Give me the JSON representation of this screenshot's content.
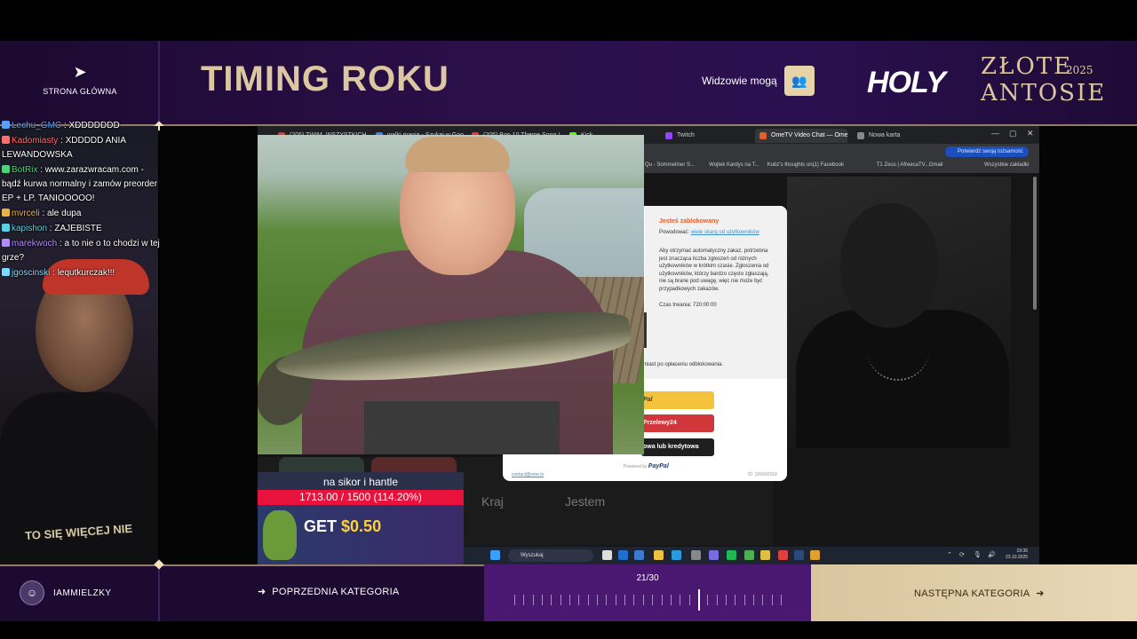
{
  "header": {
    "home_label": "STRONA GŁÓWNA",
    "page_title": "TIMING ROKU",
    "viewers_label": "Widzowie mogą",
    "logo_left": "HOLY",
    "logo_top": "ZŁOTE",
    "logo_year": "2025",
    "logo_bottom": "ANTOSIE"
  },
  "chat": [
    {
      "user": "Lechu_GMC",
      "text": " : XDDDDDDD",
      "color": "#5aa0ff"
    },
    {
      "user": "Kadomiasty",
      "text": " : XDDDDD ANIA LEWANDOWSKA",
      "color": "#ff6f6f"
    },
    {
      "user": "BotRix",
      "text": " : www.zarazwracam.com - bądź kurwa normalny i zamów preorder EP + LP. TANIOOOOO!",
      "color": "#4fd17a"
    },
    {
      "user": "mvrceli",
      "text": " : ale dupa",
      "color": "#e8b24a"
    },
    {
      "user": "kapishon",
      "text": " : ZAJEBISTE",
      "color": "#5bd0e0"
    },
    {
      "user": "marekwoch",
      "text": " : a to nie o to chodzi w tej grze?",
      "color": "#b28cff"
    },
    {
      "user": "jgoscinski",
      "text": " : lequtkurczak!!!",
      "color": "#7fd8ff"
    }
  ],
  "camera": {
    "shirt_text": "TO SIĘ WIĘCEJ NIE"
  },
  "browser": {
    "tabs": [
      "(205) TWIM, WSZYSTKICH TWO...",
      "walki mania - Szukaj w Google",
      "(205) Bon 10 Theme Song (li...",
      "Kick",
      "Twitch",
      "OmeTV Video Chat — Ome...",
      "Nowa karta"
    ],
    "verify_label": "Potwierdź swoją tożsamość",
    "bookmarks": [
      "Qu - Sommeliner S...",
      "Wojtek Kardys na T...",
      "Kubz's thoughts on...",
      "(1) Facebook",
      "T1 Zeus | AfreecaTV...",
      "Gmail",
      "Wszystkie zakładki"
    ]
  },
  "ban_modal": {
    "title": "Jesteś zablokowany",
    "reason_prefix": "Powodować: ",
    "reason_link": "wiele skarg od użytkowników",
    "description": "Aby otrzymać automatyczny zakaz, potrzebna jest znacząca liczba zgłoszeń od różnych użytkowników w krótkim czasie. Zgłoszenia od użytkowników, którzy bardzo często zgłaszają, nie są brane pod uwagę, więc nie może być przypadkowych zakazów.",
    "duration": "Czas trwania: 720:00:00",
    "after_payment": "miast po opłaceniu odblokowania.",
    "paypal_label": "Pal",
    "p24_label": "Przelewy24",
    "card_label": "owa lub kredytowa",
    "contact": "contact@ome.tv",
    "powered_prefix": "Powered by",
    "powered_brand": "PayPal",
    "id_label": "ID: 326602918"
  },
  "background_page": {
    "kraj": "Kraj",
    "jestem": "Jestem"
  },
  "taskbar": {
    "search_placeholder": "Wyszukaj",
    "time": "19:36",
    "date": "23.10.2025"
  },
  "goal": {
    "title": "na sikor i hantle",
    "progress_text": "1713.00 / 1500 (114.20%)",
    "progress_fraction": 1.142,
    "promo_get": "GET",
    "promo_amount": "$0.50"
  },
  "footer": {
    "streamer_name": "IAMMIELZKY",
    "prev_label": "POPRZEDNIA KATEGORIA",
    "counter": "21/30",
    "current": 21,
    "total": 30,
    "next_label": "NASTĘPNA KATEGORIA"
  },
  "colors": {
    "gold": "#dcc7a1",
    "purple": "#2a0f48",
    "accent_red": "#e8123c"
  }
}
